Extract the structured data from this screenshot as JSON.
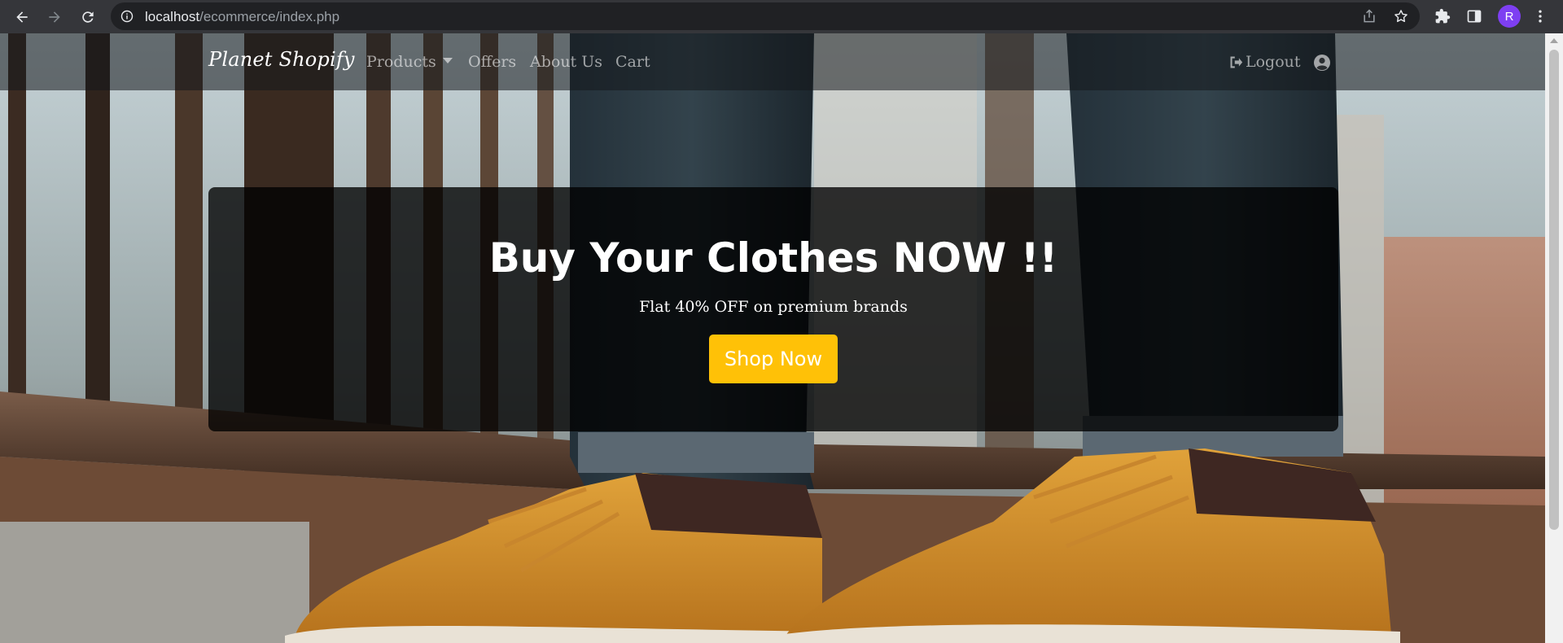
{
  "browser": {
    "url_host": "localhost",
    "url_path": "/ecommerce/index.php",
    "profile_initial": "R"
  },
  "navbar": {
    "brand": "Planet Shopify",
    "links": [
      "Products",
      "Offers",
      "About Us",
      "Cart"
    ],
    "logout_label": "Logout"
  },
  "hero": {
    "title": "Buy Your Clothes NOW !!",
    "subtitle": "Flat 40% OFF on premium brands",
    "cta_label": "Shop Now"
  },
  "colors": {
    "accent": "#ffc107",
    "chrome_bar": "#35363a",
    "profile": "#7e3ff2"
  }
}
